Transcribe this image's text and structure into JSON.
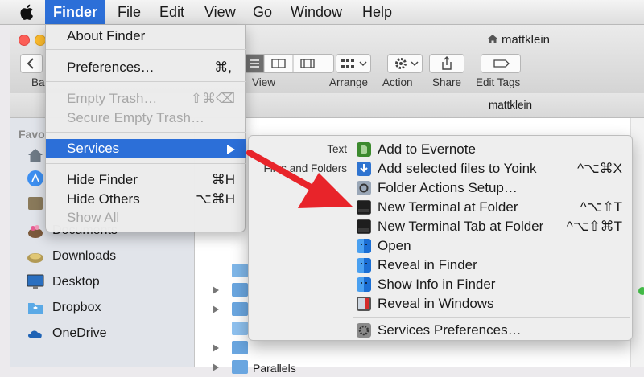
{
  "menubar": {
    "items": [
      "Finder",
      "File",
      "Edit",
      "View",
      "Go",
      "Window",
      "Help"
    ]
  },
  "window": {
    "title": "mattklein",
    "path_title": "mattklein",
    "toolbar": {
      "back_label": "Ba",
      "view_label": "View",
      "arrange_label": "Arrange",
      "action_label": "Action",
      "share_label": "Share",
      "edit_tags_label": "Edit Tags"
    }
  },
  "sidebar": {
    "heading": "Favo",
    "items": [
      {
        "label": "Documents",
        "icon": "documents-icon"
      },
      {
        "label": "Downloads",
        "icon": "downloads-icon"
      },
      {
        "label": "Desktop",
        "icon": "desktop-icon"
      },
      {
        "label": "Dropbox",
        "icon": "dropbox-icon"
      },
      {
        "label": "OneDrive",
        "icon": "onedrive-icon"
      }
    ]
  },
  "filelist": {
    "last_row_label": "Parallels"
  },
  "finder_menu": {
    "items": [
      {
        "label": "About Finder",
        "shortcut": "",
        "enabled": true
      },
      {
        "label": "Preferences…",
        "shortcut": "⌘,",
        "enabled": true
      },
      {
        "label": "Empty Trash…",
        "shortcut": "⇧⌘⌫",
        "enabled": false
      },
      {
        "label": "Secure Empty Trash…",
        "shortcut": "",
        "enabled": false
      },
      {
        "label": "Services",
        "shortcut": "",
        "enabled": true,
        "highlighted": true
      },
      {
        "label": "Hide Finder",
        "shortcut": "⌘H",
        "enabled": true
      },
      {
        "label": "Hide Others",
        "shortcut": "⌥⌘H",
        "enabled": true
      },
      {
        "label": "Show All",
        "shortcut": "",
        "enabled": false
      }
    ]
  },
  "services_menu": {
    "categories": [
      "Text",
      "Files and Folders"
    ],
    "items": [
      {
        "label": "Add to Evernote",
        "shortcut": "",
        "icon": "evernote-icon"
      },
      {
        "label": "Add selected files to Yoink",
        "shortcut": "^⌥⌘X",
        "icon": "yoink-icon"
      },
      {
        "label": "Folder Actions Setup…",
        "shortcut": "",
        "icon": "folder-actions-icon"
      },
      {
        "label": "New Terminal at Folder",
        "shortcut": "^⌥⇧T",
        "icon": "terminal-icon"
      },
      {
        "label": "New Terminal Tab at Folder",
        "shortcut": "^⌥⇧⌘T",
        "icon": "terminal-icon"
      },
      {
        "label": "Open",
        "shortcut": "",
        "icon": "finder-icon"
      },
      {
        "label": "Reveal in Finder",
        "shortcut": "",
        "icon": "finder-icon"
      },
      {
        "label": "Show Info in Finder",
        "shortcut": "",
        "icon": "finder-icon"
      },
      {
        "label": "Reveal in Windows",
        "shortcut": "",
        "icon": "parallels-icon"
      },
      {
        "label": "Services Preferences…",
        "shortcut": "",
        "icon": "gear-icon"
      }
    ]
  },
  "colors": {
    "accent": "#2c6fd8",
    "annotation_arrow": "#e8242a"
  }
}
